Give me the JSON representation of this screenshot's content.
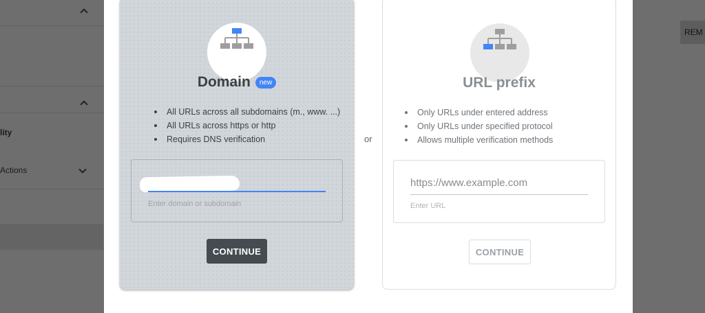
{
  "background": {
    "left_rows": [
      {
        "label": ""
      },
      {
        "label": ""
      },
      {
        "label": "lity"
      },
      {
        "label": "Actions"
      },
      {
        "label": ""
      }
    ],
    "right_button_label": "REM"
  },
  "dialog": {
    "or_label": "or",
    "domain": {
      "icon": "sitemap-icon",
      "title": "Domain",
      "badge": "new",
      "bullets": [
        "All URLs across all subdomains (m., www. ...)",
        "All URLs across https or http",
        "Requires DNS verification"
      ],
      "input_value": "",
      "input_hint": "Enter domain or subdomain",
      "button_label": "CONTINUE"
    },
    "url_prefix": {
      "icon": "sitemap-icon",
      "title": "URL prefix",
      "bullets": [
        "Only URLs under entered address",
        "Only URLs under specified protocol",
        "Allows multiple verification methods"
      ],
      "input_placeholder": "https://www.example.com",
      "input_hint": "Enter URL",
      "button_label": "CONTINUE"
    }
  },
  "colors": {
    "accent": "#4285f4",
    "domain_card_bg": "#d1d6db",
    "primary_button": "#454b50"
  }
}
